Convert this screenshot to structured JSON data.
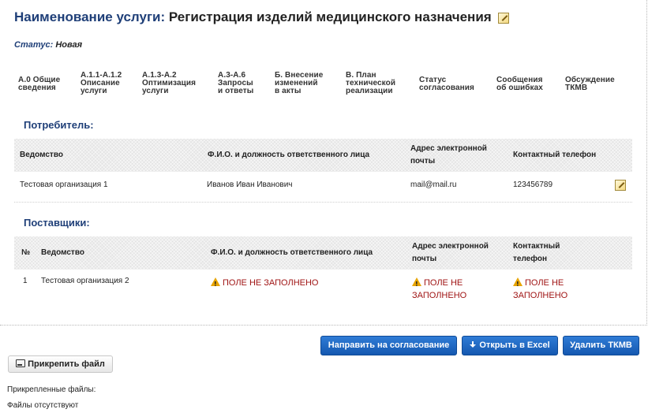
{
  "header": {
    "label": "Наименование услуги:",
    "value": "Регистрация изделий медицинского назначения"
  },
  "status": {
    "label": "Статус:",
    "value": "Новая"
  },
  "tabs": [
    "А.0 Общие\nсведения",
    "А.1.1-А.1.2\nОписание\nуслуги",
    "А.1.3-А.2\nОптимизация\nуслуги",
    "А.3-А.6\nЗапросы\nи ответы",
    "Б. Внесение\nизменений\nв акты",
    "В. План\nтехнической\nреализации",
    "Статус\nсогласования",
    "Сообщения\nоб ошибках",
    "Обсуждение\nТКМВ"
  ],
  "consumer": {
    "title": "Потребитель:",
    "columns": [
      "Ведомство",
      "Ф.И.О. и должность ответственного лица",
      "Адрес электронной\nпочты",
      "Контактный телефон"
    ],
    "rows": [
      {
        "org": "Тестовая организация 1",
        "person": "Иванов Иван Иванович",
        "email": "mail@mail.ru",
        "phone": "123456789"
      }
    ]
  },
  "suppliers": {
    "title": "Поставщики:",
    "columns": [
      "№",
      "Ведомство",
      "Ф.И.О. и должность ответственного лица",
      "Адрес электронной\nпочты",
      "Контактный\nтелефон"
    ],
    "rows": [
      {
        "num": "1",
        "org": "Тестовая организация 2",
        "person": "ПОЛЕ НЕ ЗАПОЛНЕНО",
        "email": "ПОЛЕ НЕ\nЗАПОЛНЕНО",
        "phone": "ПОЛЕ НЕ\nЗАПОЛНЕНО"
      }
    ]
  },
  "actions": {
    "approve": "Направить на согласование",
    "excel": "Открыть в Excel",
    "delete": "Удалить ТКМВ"
  },
  "attach": {
    "button": "Прикрепить файл",
    "files_label": "Прикрепленные файлы:",
    "no_files": "Файлы отсутствуют"
  },
  "colors": {
    "accent": "#1f3f78",
    "button": "#1a63c2",
    "warning": "#a01515"
  }
}
